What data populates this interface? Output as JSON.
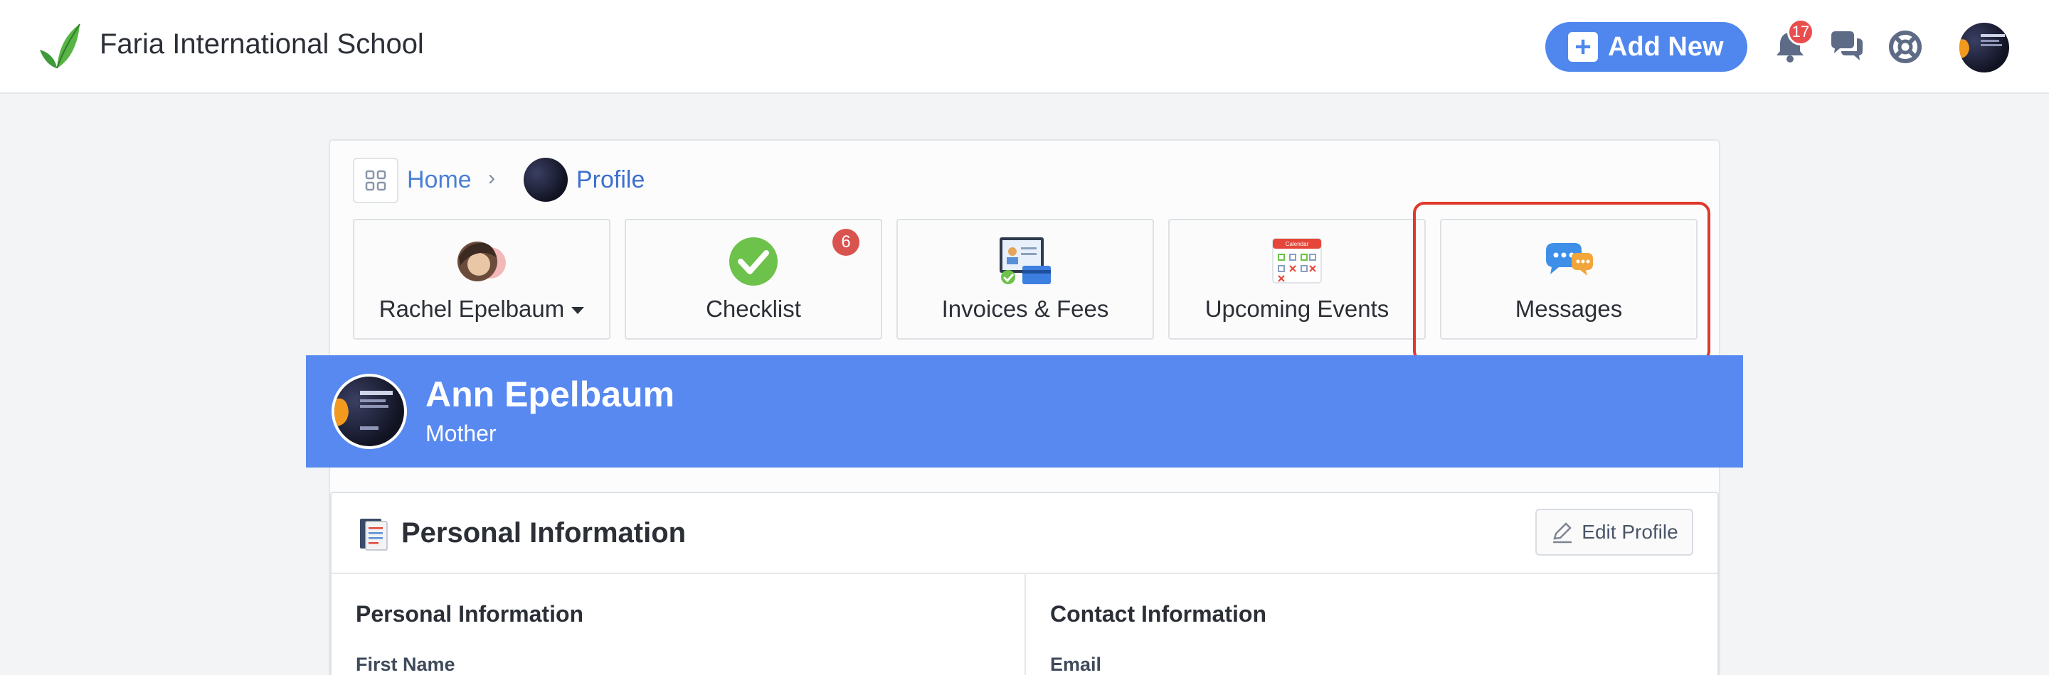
{
  "header": {
    "school_name": "Faria International School",
    "add_new_label": "Add New",
    "notification_count": "17"
  },
  "breadcrumb": {
    "home": "Home",
    "profile": "Profile"
  },
  "tiles": [
    {
      "label": "Rachel Epelbaum",
      "icon": "student-avatars-icon"
    },
    {
      "label": "Checklist",
      "icon": "checkmark-circle-icon",
      "badge": "6"
    },
    {
      "label": "Invoices & Fees",
      "icon": "invoice-card-icon"
    },
    {
      "label": "Upcoming Events",
      "icon": "calendar-icon",
      "icon_text": "Calendar"
    },
    {
      "label": "Messages",
      "icon": "chat-bubbles-icon"
    }
  ],
  "banner": {
    "name": "Ann Epelbaum",
    "role": "Mother"
  },
  "personal_info": {
    "title": "Personal Information",
    "edit_label": "Edit Profile",
    "left_section": "Personal Information",
    "right_section": "Contact Information",
    "left_field": "First Name",
    "right_field": "Email"
  },
  "colors": {
    "accent": "#4f87ee",
    "banner": "#5789f0",
    "badge": "#e84e4e",
    "highlight": "#e0382b"
  }
}
